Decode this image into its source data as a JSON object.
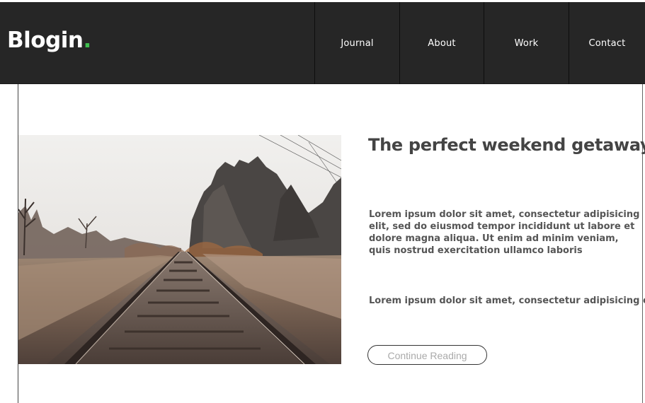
{
  "header": {
    "logo_text": "Blogin",
    "logo_dot": ".",
    "nav": [
      {
        "label": "Journal"
      },
      {
        "label": "About"
      },
      {
        "label": "Work"
      },
      {
        "label": "Contact"
      }
    ]
  },
  "article": {
    "image_subject": "railway tracks",
    "title": "The perfect weekend getaway",
    "paragraph_1": "Lorem ipsum dolor sit amet, consectetur adipisicing elit, sed do eiusmod tempor incididunt ut labore et dolore magna aliqua. Ut enim ad minim veniam, quis nostrud exercitation ullamco laboris",
    "paragraph_2": "Lorem ipsum dolor sit amet, consectetur adipisicing elit",
    "button_label": "Continue Reading"
  },
  "colors": {
    "header_bg": "#262626",
    "accent_dot": "#3fbf4f",
    "text": "#444444"
  }
}
